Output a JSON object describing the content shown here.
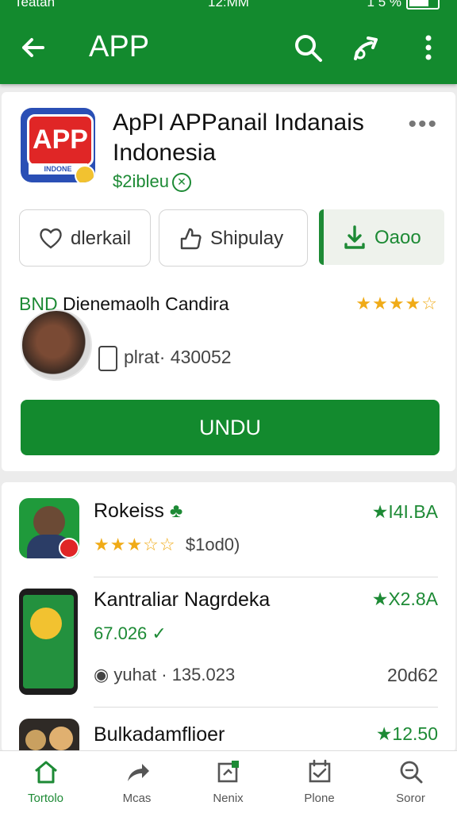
{
  "status_bar": {
    "left": "Teatan",
    "center": "12:MM",
    "right": "1 5 %"
  },
  "toolbar": {
    "title": "APP",
    "icons": [
      "back-arrow-icon",
      "search-icon",
      "share-icon",
      "more-vert-icon"
    ]
  },
  "app": {
    "logo_text": "APP",
    "logo_band": "INDONE",
    "title": "ApPI APPanail Indanais Indonesia",
    "price": "$2ibleu",
    "actions": [
      {
        "label": "dlerkail",
        "icon": "heart-icon"
      },
      {
        "label": "Shipulay",
        "icon": "thumb-icon"
      },
      {
        "label": "Oaoo",
        "icon": "download-icon"
      }
    ],
    "developer_prefix": "BND ",
    "developer": "Dienemaolh Candira",
    "stars": "★★★★☆",
    "meta": "plrat· 430052",
    "primary_button": "UNDU"
  },
  "related": [
    {
      "name": "Rokeiss",
      "rating": "★I4I.BA",
      "stars": "★★★☆☆",
      "sub": "$1od0)"
    },
    {
      "name": "Kantraliar Nagrdeka",
      "rating": "★X2.8A",
      "sub": "67.026",
      "sub2": "yuhat · 135.023",
      "extra": "20d62"
    },
    {
      "name": "Bulkadamflioer",
      "rating": "★12.50"
    }
  ],
  "bottom_nav": [
    {
      "label": "Tortolo",
      "icon": "home-icon"
    },
    {
      "label": "Mcas",
      "icon": "share-arrow-icon"
    },
    {
      "label": "Nenix",
      "icon": "apps-icon"
    },
    {
      "label": "Plone",
      "icon": "calendar-icon"
    },
    {
      "label": "Soror",
      "icon": "search-icon"
    }
  ],
  "colors": {
    "primary": "#138a2e",
    "accent": "#1d8a35",
    "star": "#f0ab17"
  }
}
